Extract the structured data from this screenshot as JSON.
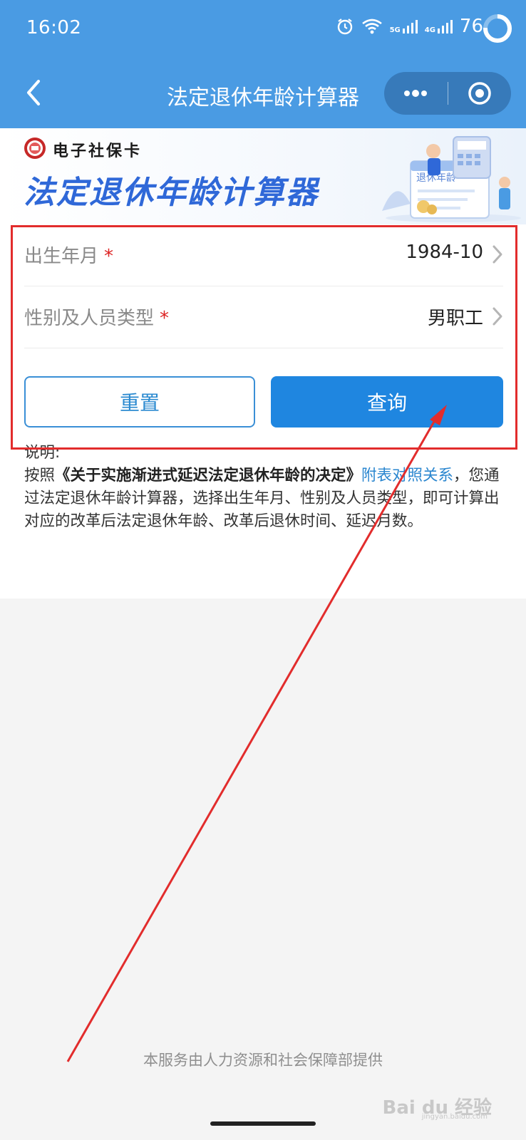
{
  "status_bar": {
    "time": "16:02",
    "network_5g": "5G",
    "network_4g": "4G",
    "battery": "76"
  },
  "nav": {
    "title": "法定退休年龄计算器"
  },
  "banner": {
    "brand": "电子社保卡",
    "title": "法定退休年龄计算器",
    "illustration_label": "退休年龄"
  },
  "form": {
    "birth": {
      "label": "出生年月",
      "required_mark": "*",
      "value": "1984-10"
    },
    "type": {
      "label": "性别及人员类型",
      "required_mark": "*",
      "value": "男职工"
    },
    "reset_label": "重置",
    "query_label": "查询"
  },
  "notes": {
    "heading": "说明:",
    "prefix": "按照",
    "decision": "《关于实施渐进式延迟法定退休年龄的决定》",
    "link": "附表对照关系",
    "rest": "，您通过法定退休年龄计算器，选择出生年月、性别及人员类型，即可计算出对应的改革后法定退休年龄、改革后退休时间、延迟月数。"
  },
  "footer": {
    "text": "本服务由人力资源和社会保障部提供"
  },
  "watermark": {
    "text": "Bai du 经验",
    "sub": "jingyan.baidu.com"
  },
  "colors": {
    "header": "#4a9be3",
    "primary": "#1f86e0",
    "highlight_box": "#e22c2c",
    "link": "#2a86cf"
  }
}
